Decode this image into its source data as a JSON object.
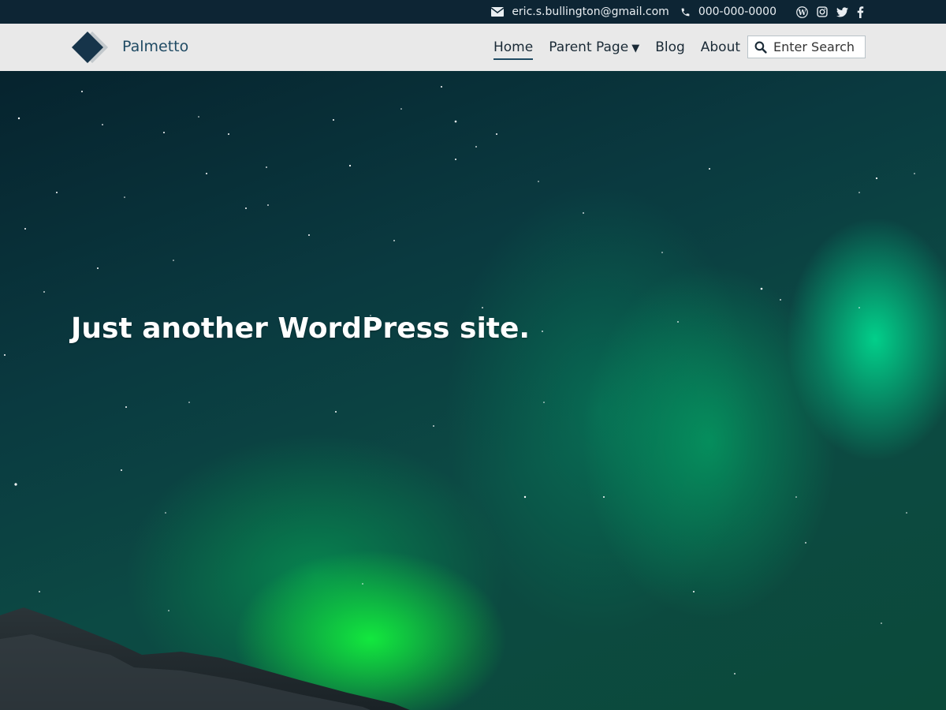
{
  "topbar": {
    "email": "eric.s.bullington@gmail.com",
    "phone": "000-000-0000",
    "social_icons": [
      "wordpress-icon",
      "instagram-icon",
      "twitter-icon",
      "facebook-icon"
    ]
  },
  "header": {
    "site_title": "Palmetto",
    "nav": [
      {
        "label": "Home",
        "active": true
      },
      {
        "label": "Parent Page",
        "has_dropdown": true
      },
      {
        "label": "Blog"
      },
      {
        "label": "About"
      }
    ],
    "search_placeholder": "Enter Search"
  },
  "hero": {
    "tagline": "Just another WordPress site."
  },
  "colors": {
    "topbar_bg": "#0d2534",
    "header_bg": "#e9e9e9",
    "brand": "#1f4a63"
  }
}
